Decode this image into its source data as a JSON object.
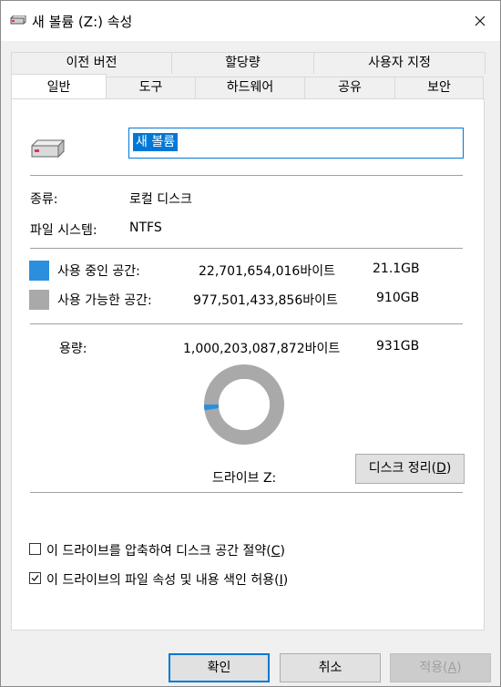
{
  "window": {
    "title": "새 볼륨 (Z:) 속성"
  },
  "tabs_top": [
    {
      "label": "이전 버전"
    },
    {
      "label": "할당량"
    },
    {
      "label": "사용자 지정"
    }
  ],
  "tabs_bottom": [
    {
      "label": "일반"
    },
    {
      "label": "도구"
    },
    {
      "label": "하드웨어"
    },
    {
      "label": "공유"
    },
    {
      "label": "보안"
    }
  ],
  "general": {
    "volume_name": "새 볼륨",
    "type_label": "종류:",
    "type_value": "로컬 디스크",
    "fs_label": "파일 시스템:",
    "fs_value": "NTFS",
    "used": {
      "label": "사용 중인 공간:",
      "bytes": "22,701,654,016바이트",
      "size": "21.1GB",
      "color": "#2b8fde"
    },
    "free": {
      "label": "사용 가능한 공간:",
      "bytes": "977,501,433,856바이트",
      "size": "910GB",
      "color": "#a9a9a9"
    },
    "capacity": {
      "label": "용량:",
      "bytes": "1,000,203,087,872바이트",
      "size": "931GB"
    },
    "used_fraction": 0.0227,
    "drive_label": "드라이브 Z:",
    "cleanup": {
      "label": "디스크 정리(",
      "key": "D",
      "suffix": ")"
    },
    "compress": {
      "checked": false,
      "label": "이 드라이브를 압축하여 디스크 공간 절약(",
      "key": "C",
      "suffix": ")"
    },
    "index": {
      "checked": true,
      "label": "이 드라이브의 파일 속성 및 내용 색인 허용(",
      "key": "I",
      "suffix": ")"
    }
  },
  "footer": {
    "ok": "확인",
    "cancel": "취소",
    "apply": {
      "label": "적용(",
      "key": "A",
      "suffix": ")"
    }
  }
}
